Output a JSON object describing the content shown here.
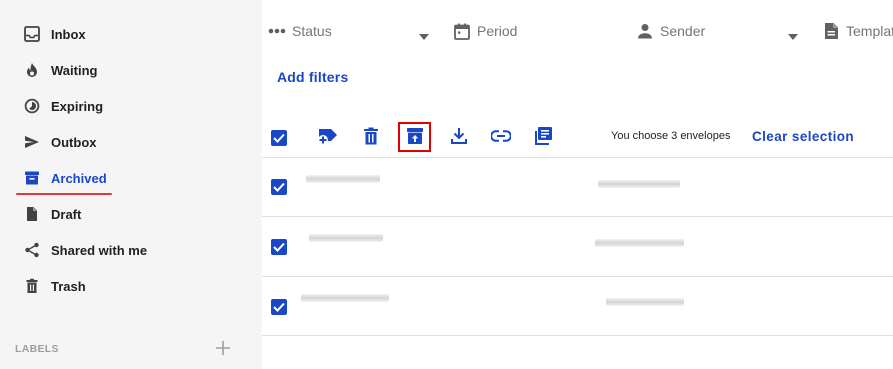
{
  "sidebar": {
    "items": [
      {
        "label": "Inbox",
        "icon": "inbox-icon"
      },
      {
        "label": "Waiting",
        "icon": "flame-icon"
      },
      {
        "label": "Expiring",
        "icon": "expiring-clock-icon"
      },
      {
        "label": "Outbox",
        "icon": "send-icon"
      },
      {
        "label": "Archived",
        "icon": "archive-icon",
        "active": true
      },
      {
        "label": "Draft",
        "icon": "draft-file-icon"
      },
      {
        "label": "Shared with me",
        "icon": "share-icon"
      },
      {
        "label": "Trash",
        "icon": "trash-icon"
      }
    ],
    "labels_heading": "LABELS"
  },
  "filters": {
    "status": "Status",
    "period": "Period",
    "sender": "Sender",
    "template": "Templat",
    "add_filters": "Add filters"
  },
  "toolbar": {
    "selected_text": "You choose 3 envelopes",
    "clear_selection": "Clear selection",
    "buttons": [
      "add-label-icon",
      "delete-icon",
      "unarchive-icon",
      "download-icon",
      "link-icon",
      "bulk-edit-icon"
    ]
  },
  "colors": {
    "accent": "#1a47c8",
    "highlight": "#e00000",
    "sidebar_bg": "#f5f5f5"
  }
}
